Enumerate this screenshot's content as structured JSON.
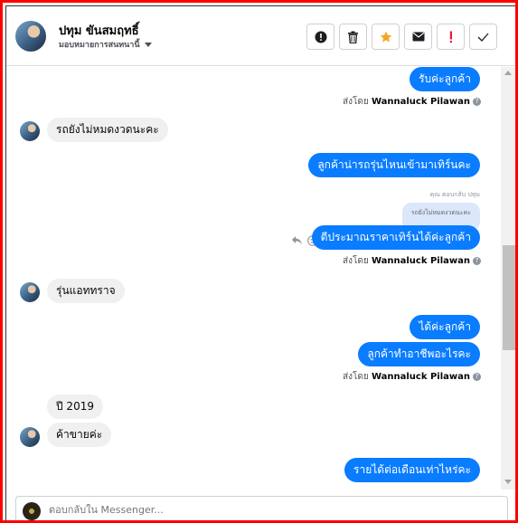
{
  "header": {
    "name": "ปทุม ขันสมฤทธิ์",
    "assign_label": "มอบหมายการสนทนานี้"
  },
  "toolbar": {
    "buttons": [
      {
        "name": "mark-spam-button",
        "icon": "alert-circle-icon"
      },
      {
        "name": "delete-button",
        "icon": "trash-icon"
      },
      {
        "name": "star-button",
        "icon": "star-icon",
        "color": "#f5a623"
      },
      {
        "name": "mark-unread-button",
        "icon": "envelope-icon"
      },
      {
        "name": "follow-up-button",
        "icon": "exclamation-icon",
        "color": "#e41e3f"
      },
      {
        "name": "mark-done-button",
        "icon": "checkmark-icon"
      }
    ]
  },
  "messages": {
    "m1": "รับค่ะลูกค้า",
    "m2": "รถยังไม่หมดงวดนะคะ",
    "m3": "ลูกค้าน่ารถรุ่นไหนเข้ามาเทิร์นคะ",
    "reply_note": "ตอบกลับ ปทุม",
    "reply_note_prefix": "คุณ",
    "quoted": "รถยังไม่หมดงวดนะคะ",
    "m4": "ตีประมาณราคาเทิร์นได้ค่ะลูกค้า",
    "m5": "รุ่นแอททราจ",
    "m6": "ได้ค่ะลูกค้า",
    "m7": "ลูกค้าทำอาชีพอะไรคะ",
    "m8": "ปี 2019",
    "m9": "ค้าขายค่ะ",
    "m10": "รายได้ต่อเดือนเท่าไหร่คะ"
  },
  "sent_by": {
    "prefix": "ส่งโดย",
    "sender": "Wannaluck Pilawan",
    "help": "?"
  },
  "composer": {
    "placeholder": "ตอบกลับใน Messenger..."
  },
  "colors": {
    "outgoing_bubble": "#0a7cff",
    "incoming_bubble": "#f0f0f0",
    "frame_border": "#ff0000"
  }
}
